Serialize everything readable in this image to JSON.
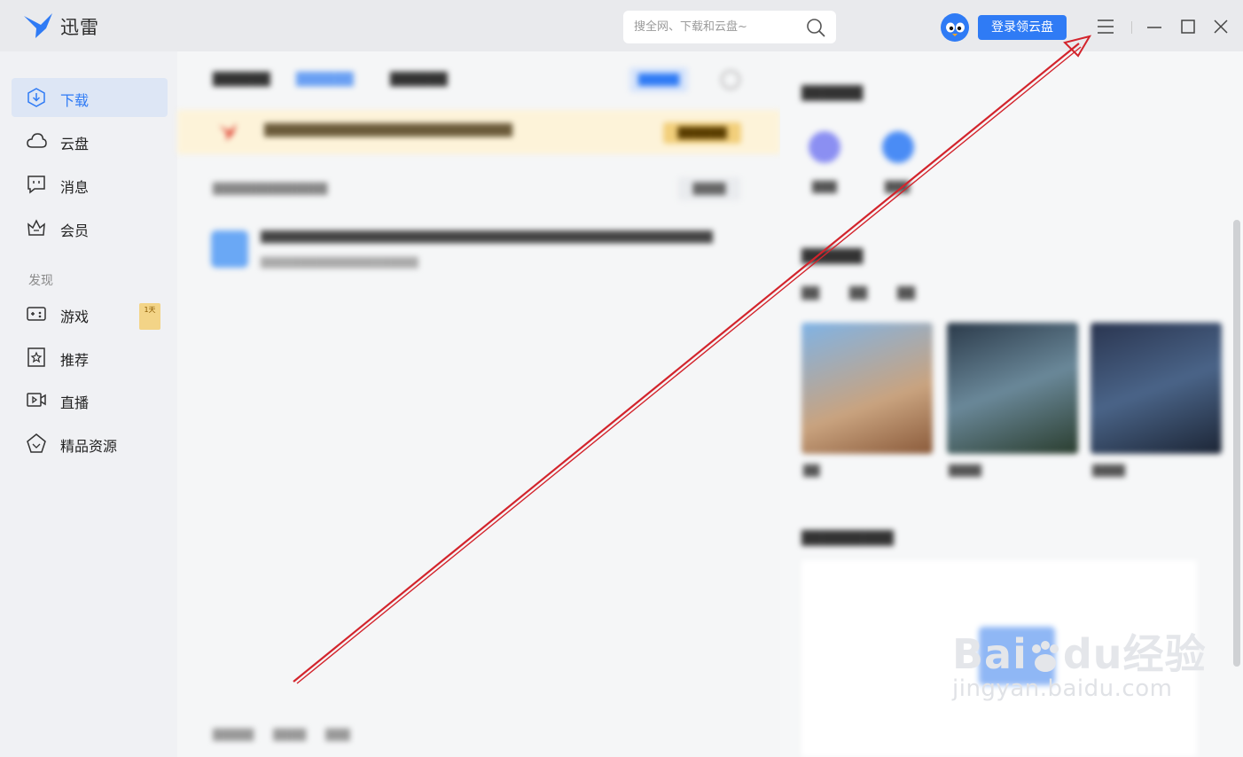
{
  "titlebar": {
    "app_name": "迅雷",
    "search_placeholder": "搜全网、下载和云盘~",
    "login_button": "登录领云盘"
  },
  "sidebar": {
    "items": [
      {
        "label": "下载",
        "icon": "download-icon",
        "active": true
      },
      {
        "label": "云盘",
        "icon": "cloud-icon"
      },
      {
        "label": "消息",
        "icon": "message-icon"
      },
      {
        "label": "会员",
        "icon": "crown-icon"
      }
    ],
    "section_label": "发现",
    "discover_items": [
      {
        "label": "游戏",
        "icon": "gamepad-icon",
        "badge": "1天"
      },
      {
        "label": "推荐",
        "icon": "star-icon"
      },
      {
        "label": "直播",
        "icon": "live-icon"
      },
      {
        "label": "精品资源",
        "icon": "gem-icon"
      }
    ]
  },
  "watermark": {
    "brand": "Bai",
    "brand_suffix": "du",
    "brand_cn": "经验",
    "url": "jingyan.baidu.com"
  },
  "colors": {
    "accent": "#2f7bf5",
    "annotation_arrow": "#d3242c"
  }
}
